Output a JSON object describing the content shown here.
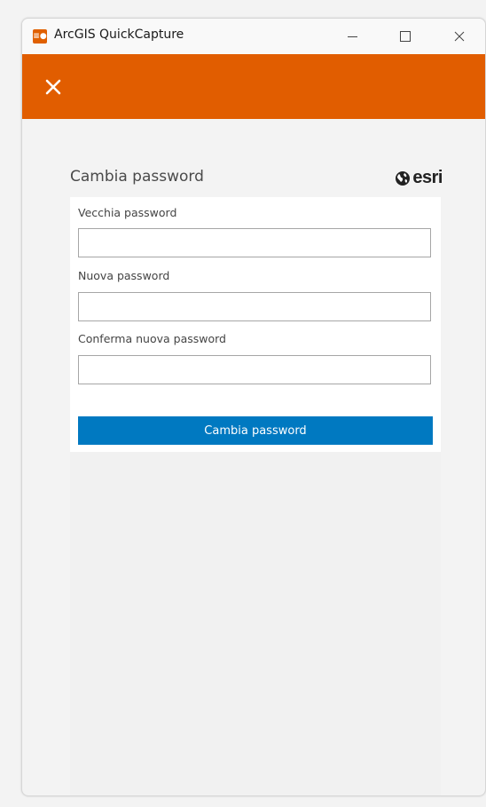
{
  "window": {
    "title": "ArcGIS QuickCapture",
    "app_icon": "quickcapture-app-icon",
    "controls": [
      "minimize-icon",
      "maximize-icon",
      "close-icon"
    ]
  },
  "appbar": {
    "close_icon": "close-icon",
    "color": "#e15d00"
  },
  "form": {
    "title": "Cambia password",
    "logo_text": "esri",
    "fields": [
      {
        "label": "Vecchia password",
        "value": "",
        "placeholder": ""
      },
      {
        "label": "Nuova password",
        "value": "",
        "placeholder": ""
      },
      {
        "label": "Conferma nuova password",
        "value": "",
        "placeholder": ""
      }
    ],
    "submit_label": "Cambia password",
    "submit_color": "#0079c1"
  }
}
